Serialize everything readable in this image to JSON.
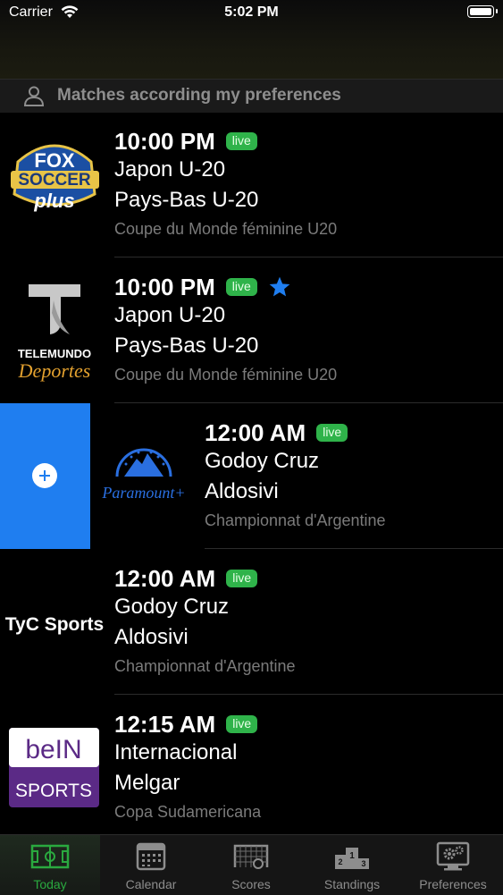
{
  "status_bar": {
    "carrier": "Carrier",
    "time": "5:02 PM"
  },
  "header": {
    "label": "Matches according my preferences"
  },
  "matches": [
    {
      "time": "10:00 PM",
      "live": "live",
      "home": "Japon U-20",
      "away": "Pays-Bas U-20",
      "competition": "Coupe du Monde féminine U20",
      "channel": "FOX SOCCER plus",
      "favorite": false
    },
    {
      "time": "10:00 PM",
      "live": "live",
      "home": "Japon U-20",
      "away": "Pays-Bas U-20",
      "competition": "Coupe du Monde féminine U20",
      "channel": "TELEMUNDO Deportes",
      "favorite": true
    },
    {
      "time": "12:00 AM",
      "live": "live",
      "home": "Godoy Cruz",
      "away": "Aldosivi",
      "competition": "Championnat d'Argentine",
      "channel": "Paramount+",
      "favorite": false
    },
    {
      "time": "12:00 AM",
      "live": "live",
      "home": "Godoy Cruz",
      "away": "Aldosivi",
      "competition": "Championnat d'Argentine",
      "channel": "TyC Sports",
      "favorite": false
    },
    {
      "time": "12:15 AM",
      "live": "live",
      "home": "Internacional",
      "away": "Melgar",
      "competition": "Copa Sudamericana",
      "channel": "beIN SPORTS",
      "favorite": false
    }
  ],
  "logos": {
    "fox_1": "FOX",
    "fox_2": "SOCCER",
    "fox_3": "plus",
    "tele_1": "TELEMUNDO",
    "tele_2": "Deportes",
    "paramount": "Paramount+",
    "tyc": "TyC Sports",
    "bein_1": "beIN",
    "bein_2": "SPORTS"
  },
  "tabs": [
    {
      "label": "Today",
      "icon": "soccer-field-icon",
      "active": true
    },
    {
      "label": "Calendar",
      "icon": "calendar-icon",
      "active": false
    },
    {
      "label": "Scores",
      "icon": "goal-net-icon",
      "active": false
    },
    {
      "label": "Standings",
      "icon": "podium-icon",
      "active": false
    },
    {
      "label": "Preferences",
      "icon": "settings-monitor-icon",
      "active": false
    }
  ],
  "colors": {
    "live_badge": "#2fb34a",
    "accent_blue": "#1f7ef0",
    "active_tab": "#2aa93f"
  }
}
